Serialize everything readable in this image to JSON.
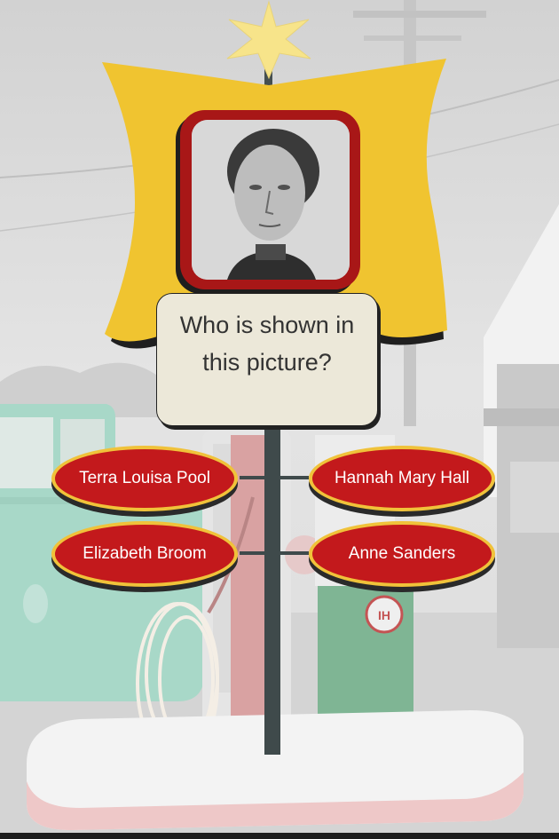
{
  "question": {
    "text_line1": "Who is shown in",
    "text_line2": "this picture?"
  },
  "answers": [
    {
      "label": "Terra Louisa Pool"
    },
    {
      "label": "Hannah Mary Hall"
    },
    {
      "label": "Elizabeth Broom"
    },
    {
      "label": "Anne Sanders"
    }
  ],
  "colors": {
    "sign_yellow": "#f0c430",
    "frame_red": "#a81717",
    "answer_red": "#c3191c",
    "answer_border": "#f0c23a",
    "card_bg": "#ece8d9",
    "star": "#f7e48a"
  },
  "icons": {
    "star": "star-icon",
    "pump_logo": "gas-pump-logo-icon"
  }
}
